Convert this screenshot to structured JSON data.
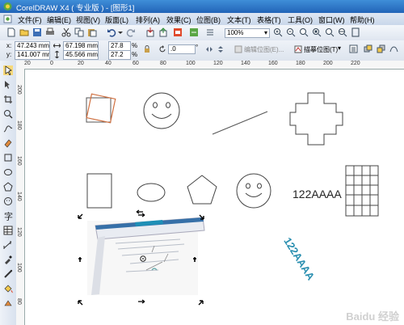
{
  "window": {
    "title": "CorelDRAW X4 ( 专业版 ) - [图形1]"
  },
  "menu": [
    "文件(F)",
    "编辑(E)",
    "视图(V)",
    "版面(L)",
    "排列(A)",
    "效果(C)",
    "位图(B)",
    "文本(T)",
    "表格(T)",
    "工具(O)",
    "窗口(W)",
    "帮助(H)"
  ],
  "toolbar": {
    "zoom": "100%"
  },
  "propbar": {
    "x": "47.243 mm",
    "y": "141.007 mm",
    "w": "67.198 mm",
    "h": "45.566 mm",
    "sx": "27.8",
    "sy": "27.2",
    "pct": "%",
    "angle": ".0",
    "edit_bitmap": "编辑位图(E)...",
    "trace_bitmap": "描摹位图(T)"
  },
  "rulers": {
    "h_ticks": [
      "20",
      "0",
      "20",
      "40",
      "60",
      "80",
      "100",
      "120",
      "140",
      "160",
      "180",
      "200",
      "220"
    ],
    "v_ticks": [
      "200",
      "180",
      "160",
      "140",
      "120",
      "100",
      "80"
    ]
  },
  "canvas": {
    "text_horizontal": "122AAAA",
    "text_rotated": "122AAAA",
    "accent_color": "#d07040",
    "rotated_text_color": "#2a8fb0"
  },
  "watermark": "Baidu 经验"
}
